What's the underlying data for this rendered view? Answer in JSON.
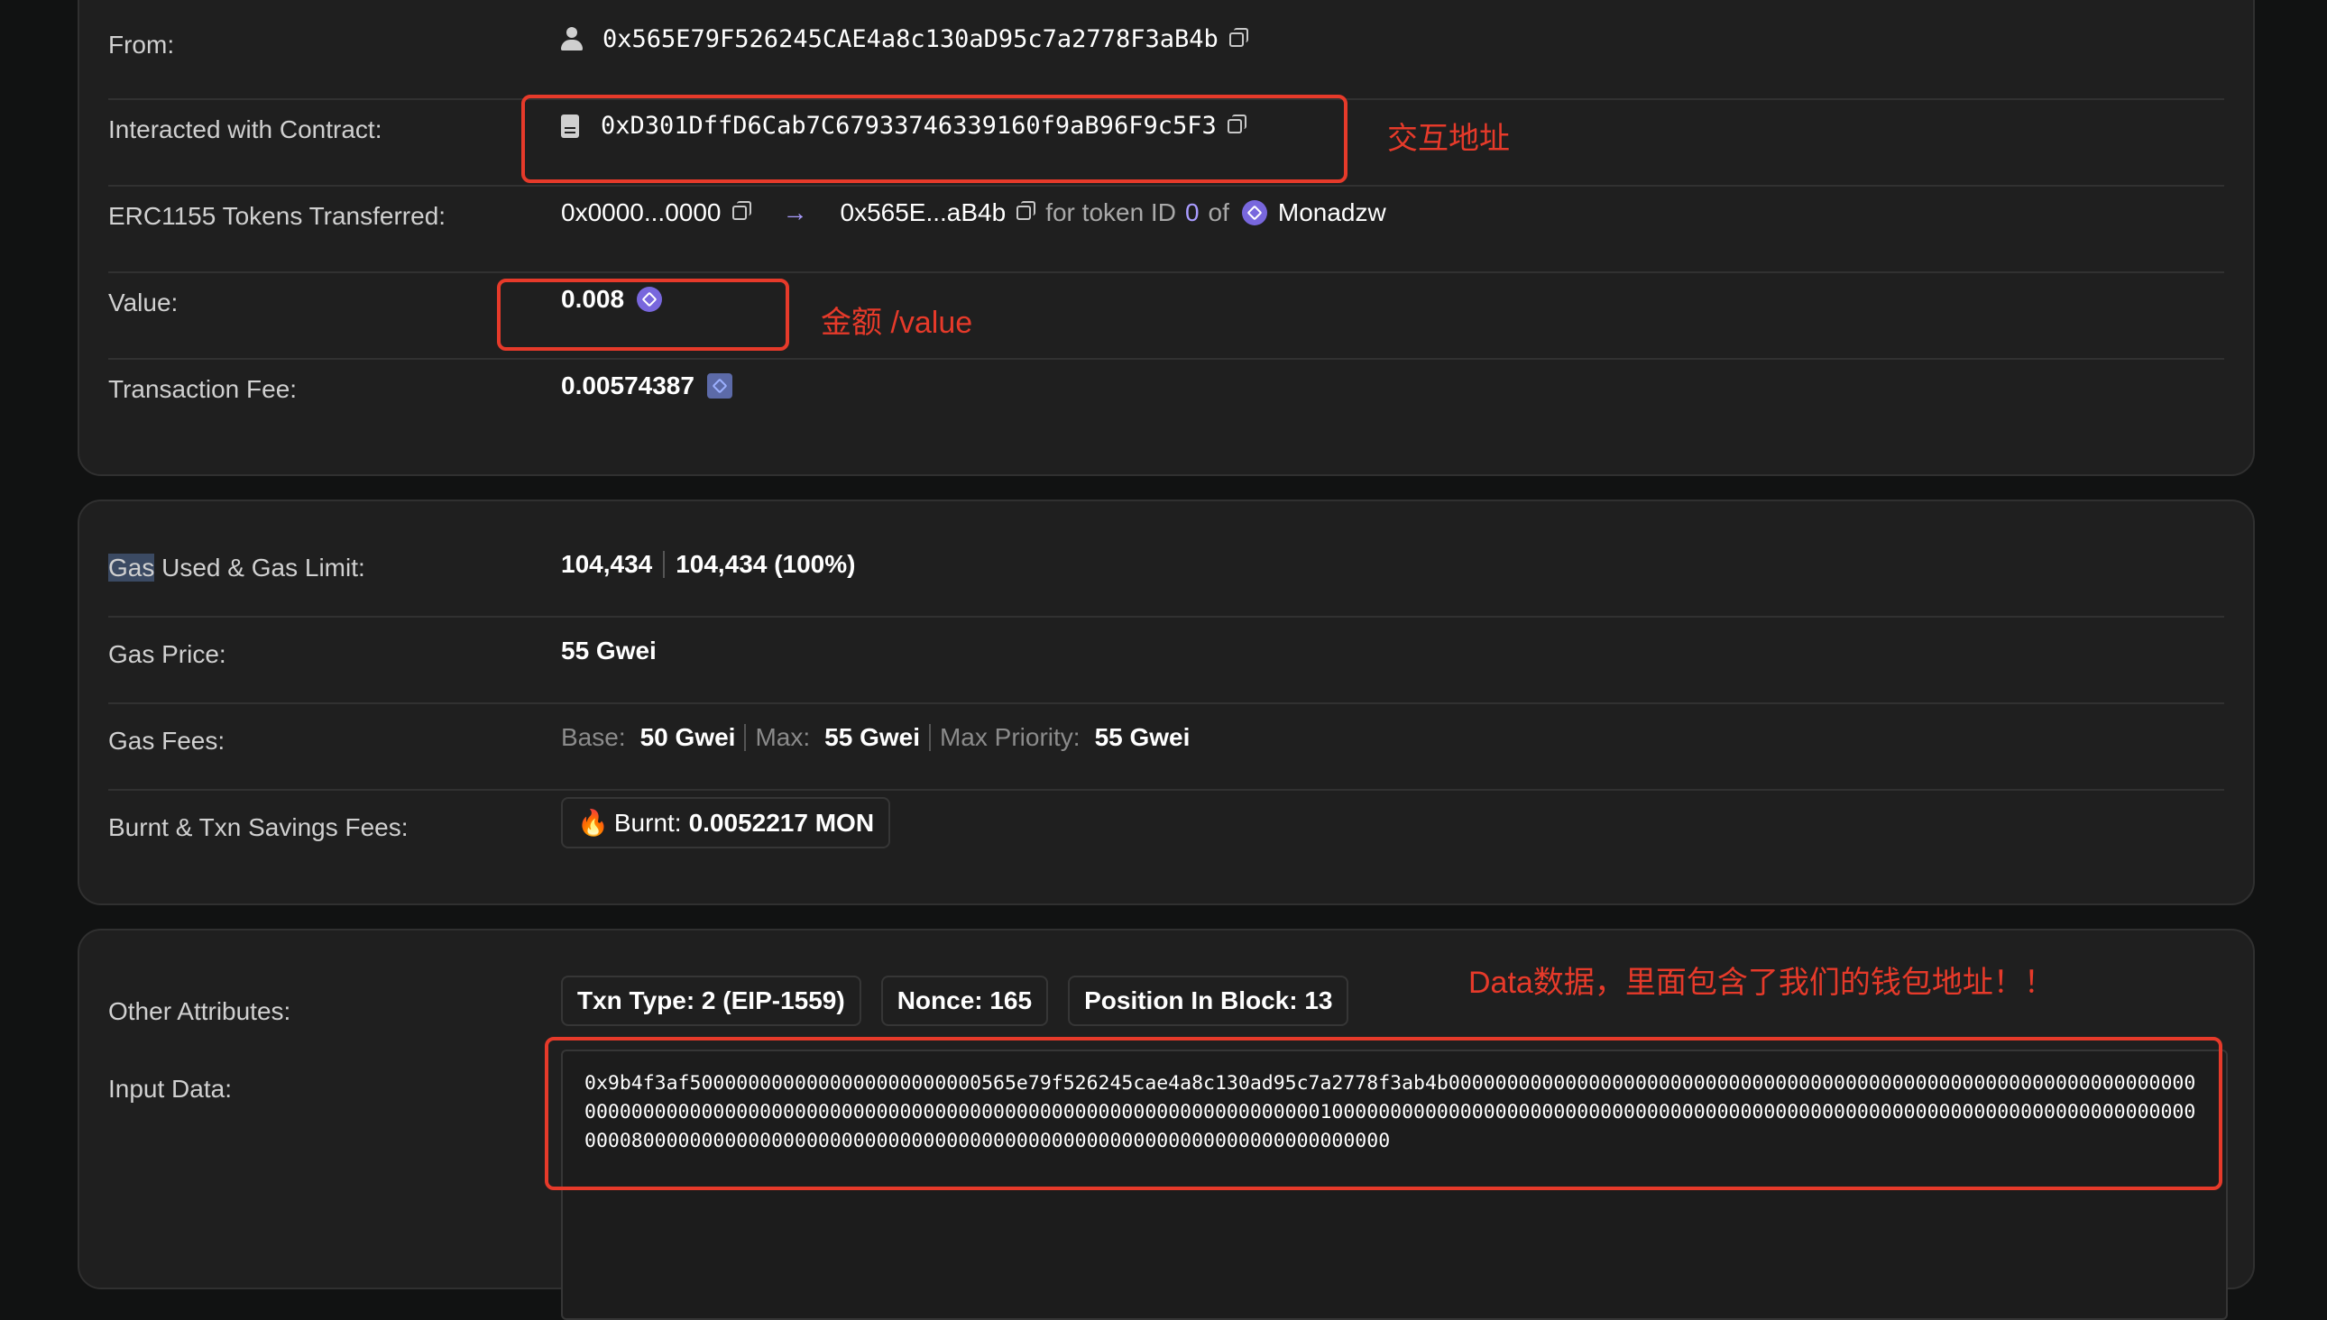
{
  "details": {
    "from": {
      "label": "From:",
      "address": "0x565E79F526245CAE4a8c130aD95c7a2778F3aB4b"
    },
    "contract": {
      "label": "Interacted with Contract:",
      "address": "0xD301DffD6Cab7C67933746339160f9aB96F9c5F3"
    },
    "erc1155": {
      "label": "ERC1155 Tokens Transferred:",
      "from_short": "0x0000...0000",
      "arrow": "→",
      "to_short": "0x565E...aB4b",
      "for_text": "for token ID",
      "token_id": "0",
      "of_text": "of",
      "token_name": "Monadzw"
    },
    "value": {
      "label": "Value:",
      "amount": "0.008"
    },
    "fee": {
      "label": "Transaction Fee:",
      "amount": "0.00574387"
    }
  },
  "gas": {
    "used_label_highlight": "Gas",
    "used_label_rest": " Used & Gas Limit:",
    "used": "104,434",
    "limit": "104,434 (100%)",
    "price_label": "Gas Price:",
    "price": "55 Gwei",
    "fees_label": "Gas Fees:",
    "base_label": "Base:",
    "base": "50 Gwei",
    "max_label": "Max:",
    "max": "55 Gwei",
    "priority_label": "Max Priority:",
    "priority": "55 Gwei",
    "burnt_label": "Burnt & Txn Savings Fees:",
    "burnt_icon": "🔥",
    "burnt_text": "Burnt:",
    "burnt_value": "0.0052217 MON"
  },
  "attributes": {
    "label": "Other Attributes:",
    "txn_type": "Txn Type: 2 (EIP-1559)",
    "nonce": "Nonce: 165",
    "position": "Position In Block: 13",
    "input_label": "Input Data:",
    "input_data": "0x9b4f3af5000000000000000000000000565e79f526245cae4a8c130ad95c7a2778f3ab4b0000000000000000000000000000000000000000000000000000000000000000000000000000000000000000000000000000000000000000000000000000000100000000000000000000000000000000000000000000000000000000000000000000000000000080000000000000000000000000000000000000000000000000000000000000000"
  },
  "annotations": {
    "contract_note": "交互地址",
    "value_note": "金额 /value",
    "data_note": "Data数据，里面包含了我们的钱包地址！！"
  },
  "colors": {
    "annotation": "#e63a2a",
    "accent_purple": "#7867dd",
    "background": "#111212",
    "card": "#1f1f1f"
  }
}
